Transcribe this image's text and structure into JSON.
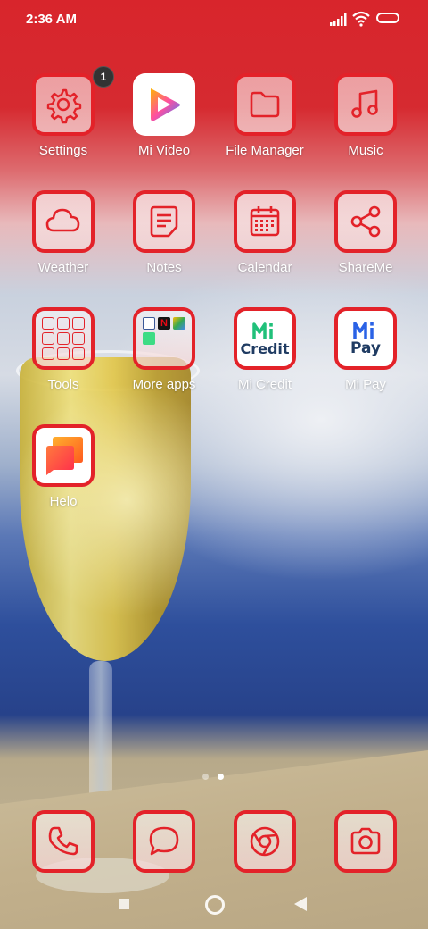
{
  "status_bar": {
    "time": "2:36 AM"
  },
  "accent_color": "#e32229",
  "apps": [
    {
      "id": "settings",
      "label": "Settings",
      "icon": "gear-icon",
      "badge": "1"
    },
    {
      "id": "mi-video",
      "label": "Mi Video",
      "icon": "play-icon"
    },
    {
      "id": "file-manager",
      "label": "File Manager",
      "icon": "folder-icon"
    },
    {
      "id": "music",
      "label": "Music",
      "icon": "music-note-icon"
    },
    {
      "id": "weather",
      "label": "Weather",
      "icon": "cloud-icon"
    },
    {
      "id": "notes",
      "label": "Notes",
      "icon": "note-icon"
    },
    {
      "id": "calendar",
      "label": "Calendar",
      "icon": "calendar-icon"
    },
    {
      "id": "shareme",
      "label": "ShareMe",
      "icon": "share-icon"
    },
    {
      "id": "tools",
      "label": "Tools",
      "icon": "folder-grid-icon"
    },
    {
      "id": "more-apps",
      "label": "More apps",
      "icon": "folder-grid-icon"
    },
    {
      "id": "mi-credit",
      "label": "Mi Credit",
      "icon": "mi-credit-icon",
      "logo_text": "Credit"
    },
    {
      "id": "mi-pay",
      "label": "Mi Pay",
      "icon": "mi-pay-icon",
      "logo_text": "Pay"
    },
    {
      "id": "helo",
      "label": "Helo",
      "icon": "chat-bubbles-icon"
    }
  ],
  "dock": [
    {
      "id": "phone",
      "icon": "phone-icon"
    },
    {
      "id": "messages",
      "icon": "message-icon"
    },
    {
      "id": "browser",
      "icon": "chrome-icon"
    },
    {
      "id": "camera",
      "icon": "camera-icon"
    }
  ],
  "pager": {
    "pages": 2,
    "current": 2
  },
  "nav": [
    "recents-button",
    "home-button",
    "back-button"
  ]
}
